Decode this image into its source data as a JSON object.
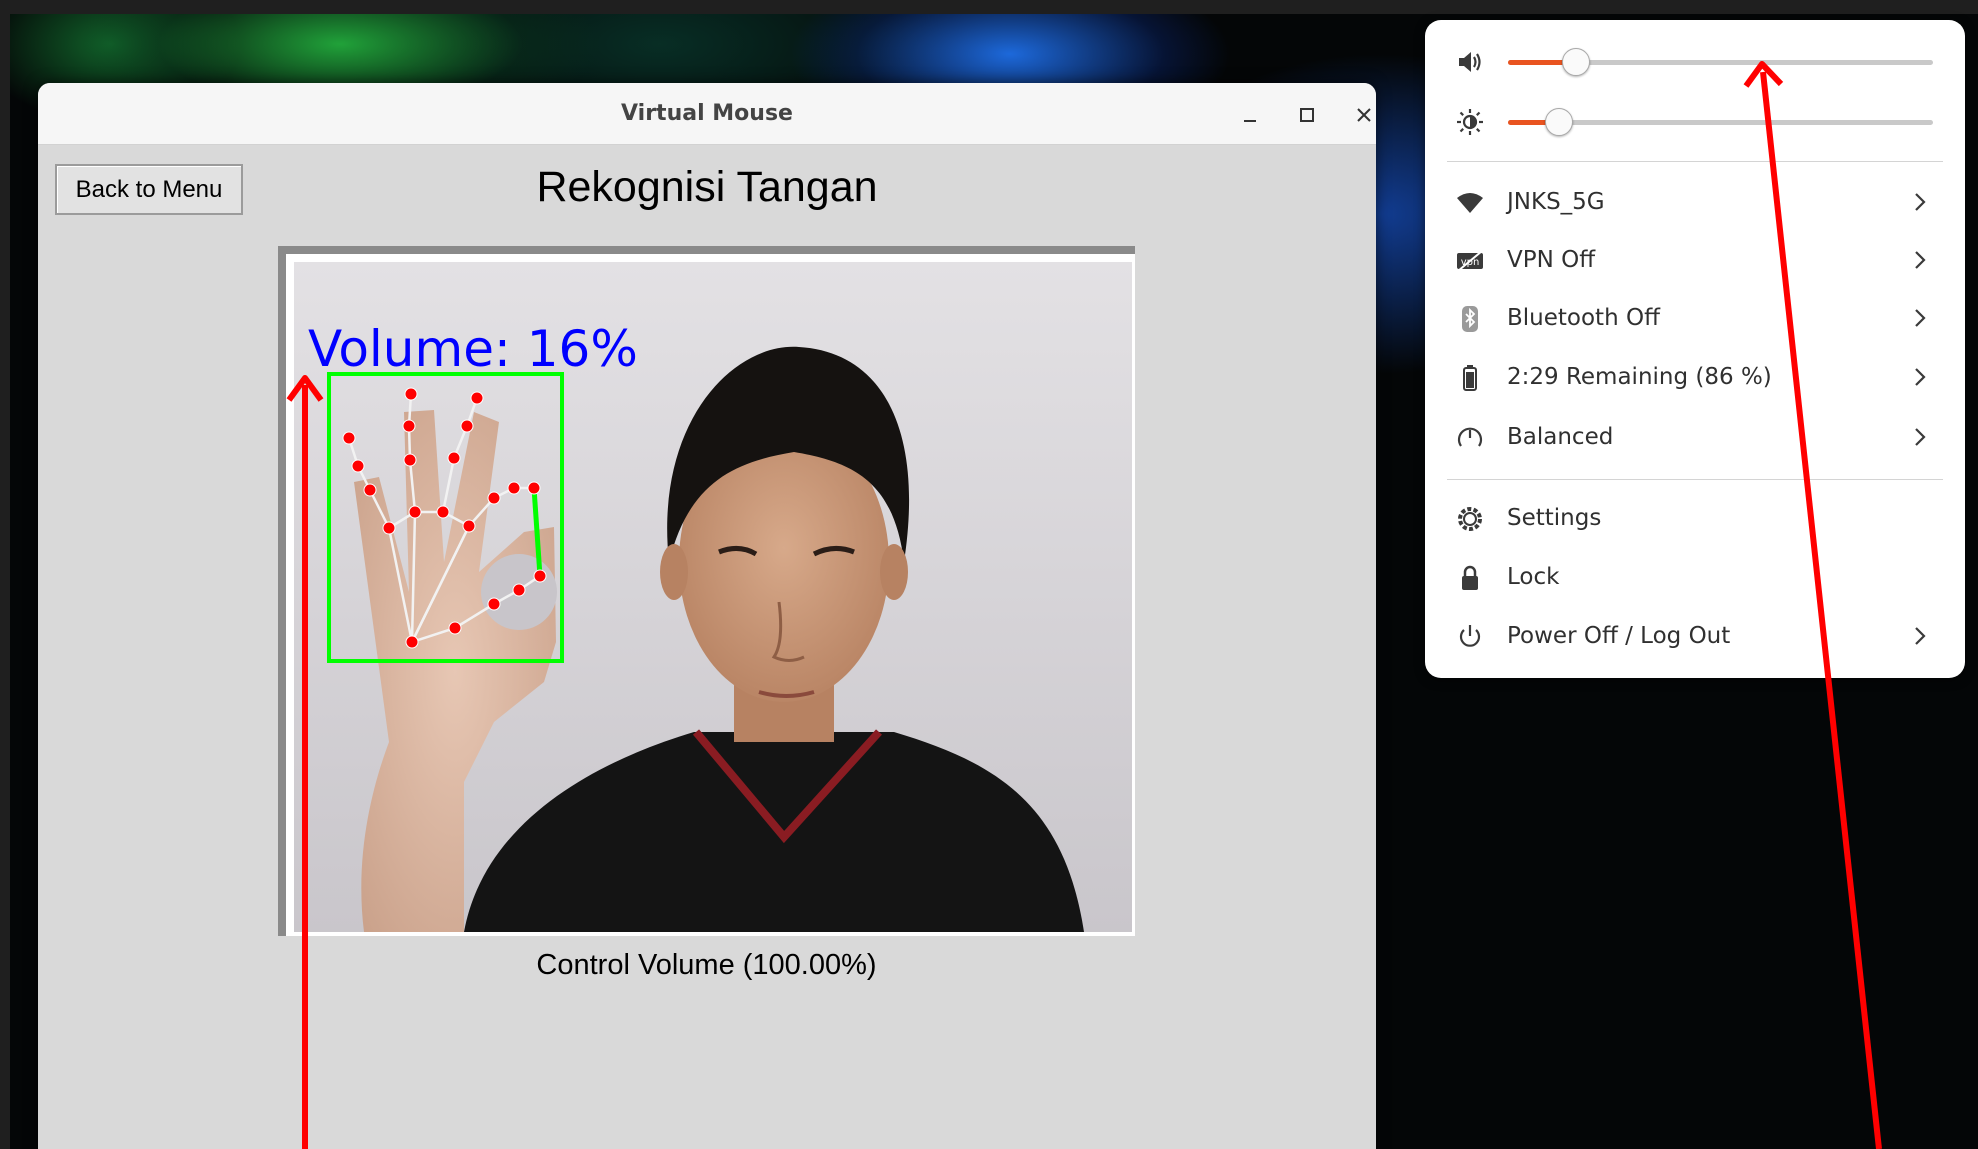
{
  "window": {
    "title": "Virtual Mouse",
    "minimize_icon": "minimize-icon",
    "maximize_icon": "maximize-icon",
    "close_icon": "close-icon"
  },
  "app": {
    "back_button_label": "Back to Menu",
    "page_title": "Rekognisi Tangan",
    "camera_overlay_text": "Volume:  16%",
    "control_label": "Control Volume (100.00%)"
  },
  "system_menu": {
    "volume_slider": {
      "icon": "speaker-icon",
      "level_percent": 16
    },
    "brightness_slider": {
      "icon": "brightness-icon",
      "level_percent": 12
    },
    "items": [
      {
        "icon": "wifi-icon",
        "label": "JNKS_5G",
        "has_submenu": true
      },
      {
        "icon": "vpn-icon",
        "label": "VPN Off",
        "has_submenu": true
      },
      {
        "icon": "bluetooth-icon",
        "label": "Bluetooth Off",
        "has_submenu": true
      },
      {
        "icon": "battery-icon",
        "label": "2:29 Remaining (86 %)",
        "has_submenu": true
      },
      {
        "icon": "power-mode-icon",
        "label": "Balanced",
        "has_submenu": true
      },
      {
        "icon": "settings-icon",
        "label": "Settings",
        "has_submenu": false
      },
      {
        "icon": "lock-icon",
        "label": "Lock",
        "has_submenu": false
      },
      {
        "icon": "power-icon",
        "label": "Power Off / Log Out",
        "has_submenu": true
      }
    ]
  },
  "colors": {
    "accent": "#e95420",
    "annotation": "#ff0000",
    "overlay_text": "#0000ff",
    "bounding_box": "#00ff00",
    "landmark": "#ff0000"
  }
}
